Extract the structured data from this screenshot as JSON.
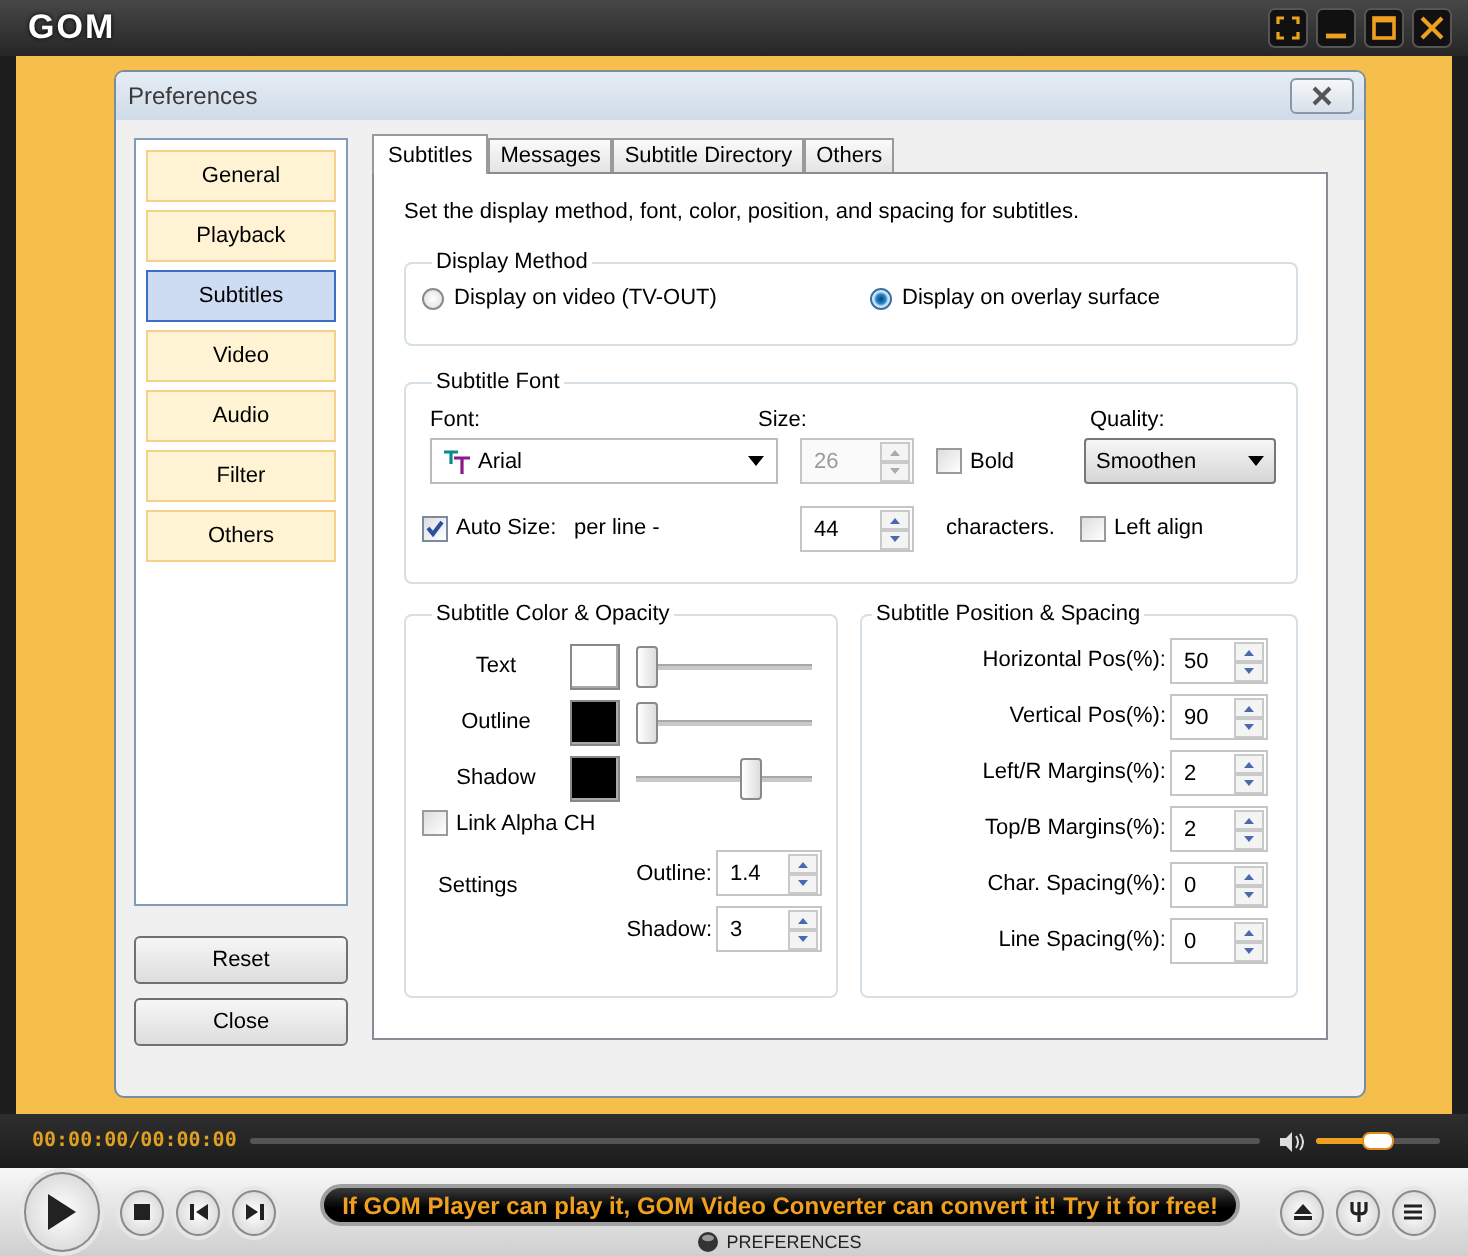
{
  "window": {
    "logo": "GOM"
  },
  "dialog": {
    "title": "Preferences"
  },
  "sidebar": {
    "items": [
      {
        "label": "General",
        "selected": false
      },
      {
        "label": "Playback",
        "selected": false
      },
      {
        "label": "Subtitles",
        "selected": true
      },
      {
        "label": "Video",
        "selected": false
      },
      {
        "label": "Audio",
        "selected": false
      },
      {
        "label": "Filter",
        "selected": false
      },
      {
        "label": "Others",
        "selected": false
      }
    ]
  },
  "buttons": [
    "Reset",
    "Close"
  ],
  "tabs": [
    {
      "label": "Subtitles",
      "selected": true
    },
    {
      "label": "Messages",
      "selected": false
    },
    {
      "label": "Subtitle Directory",
      "selected": false
    },
    {
      "label": "Others",
      "selected": false
    }
  ],
  "description": "Set the display method, font, color, position, and spacing for subtitles.",
  "display_method": {
    "title": "Display Method",
    "options": [
      {
        "label": "Display on video (TV-OUT)",
        "selected": false
      },
      {
        "label": "Display on overlay surface",
        "selected": true
      }
    ]
  },
  "subtitle_font": {
    "title": "Subtitle Font",
    "font_label": "Font:",
    "font": "Arial",
    "size_label": "Size:",
    "size": "26",
    "size_disabled": true,
    "bold": {
      "label": "Bold",
      "checked": false
    },
    "quality_label": "Quality:",
    "quality": "Smoothen",
    "auto_size": {
      "label": "Auto Size:",
      "checked": true
    },
    "per_line_label": "per line -",
    "per_line": "44",
    "characters_label": "characters.",
    "left_align": {
      "label": "Left align",
      "checked": false
    }
  },
  "color_opacity": {
    "title": "Subtitle Color & Opacity",
    "rows": [
      {
        "label": "Text",
        "color": "#ffffff",
        "level": 0
      },
      {
        "label": "Outline",
        "color": "#000000",
        "level": 0
      },
      {
        "label": "Shadow",
        "color": "#000000",
        "level": 0.68
      }
    ],
    "link_alpha": {
      "label": "Link Alpha CH",
      "checked": false
    },
    "settings_label": "Settings",
    "settings": [
      {
        "label": "Outline:",
        "value": "1.4"
      },
      {
        "label": "Shadow:",
        "value": "3"
      }
    ]
  },
  "position_spacing": {
    "title": "Subtitle Position & Spacing",
    "fields": [
      {
        "label": "Horizontal Pos(%):",
        "value": "50"
      },
      {
        "label": "Vertical Pos(%):",
        "value": "90"
      },
      {
        "label": "Left/R Margins(%):",
        "value": "2"
      },
      {
        "label": "Top/B Margins(%):",
        "value": "2"
      },
      {
        "label": "Char. Spacing(%):",
        "value": "0"
      },
      {
        "label": "Line Spacing(%):",
        "value": "0"
      }
    ]
  },
  "player": {
    "time": "00:00:00/00:00:00",
    "volume": {
      "level": 0.5
    },
    "marquee": "If GOM Player can play it, GOM Video Converter can convert it! Try it for free!",
    "status": "PREFERENCES"
  }
}
